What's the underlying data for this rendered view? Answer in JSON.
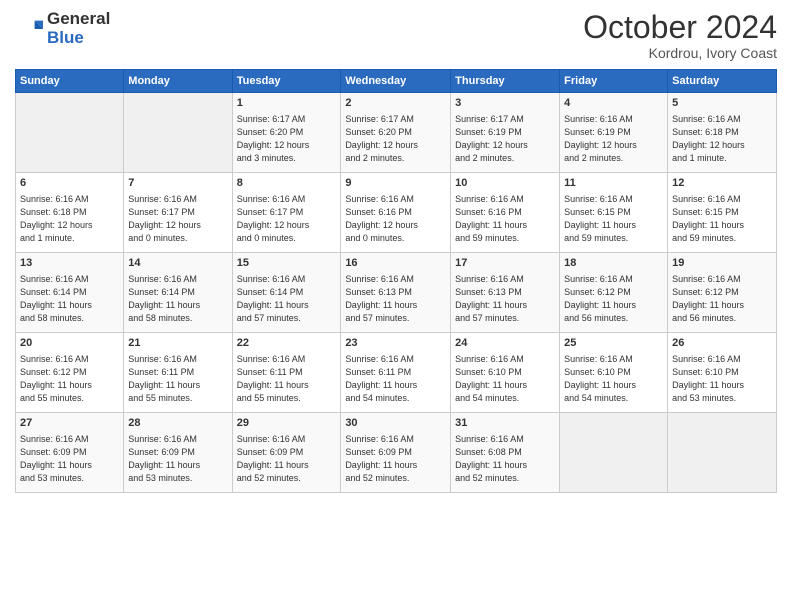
{
  "header": {
    "logo_line1": "General",
    "logo_line2": "Blue",
    "month_title": "October 2024",
    "location": "Kordrou, Ivory Coast"
  },
  "weekdays": [
    "Sunday",
    "Monday",
    "Tuesday",
    "Wednesday",
    "Thursday",
    "Friday",
    "Saturday"
  ],
  "weeks": [
    [
      {
        "num": "",
        "info": ""
      },
      {
        "num": "",
        "info": ""
      },
      {
        "num": "1",
        "info": "Sunrise: 6:17 AM\nSunset: 6:20 PM\nDaylight: 12 hours\nand 3 minutes."
      },
      {
        "num": "2",
        "info": "Sunrise: 6:17 AM\nSunset: 6:20 PM\nDaylight: 12 hours\nand 2 minutes."
      },
      {
        "num": "3",
        "info": "Sunrise: 6:17 AM\nSunset: 6:19 PM\nDaylight: 12 hours\nand 2 minutes."
      },
      {
        "num": "4",
        "info": "Sunrise: 6:16 AM\nSunset: 6:19 PM\nDaylight: 12 hours\nand 2 minutes."
      },
      {
        "num": "5",
        "info": "Sunrise: 6:16 AM\nSunset: 6:18 PM\nDaylight: 12 hours\nand 1 minute."
      }
    ],
    [
      {
        "num": "6",
        "info": "Sunrise: 6:16 AM\nSunset: 6:18 PM\nDaylight: 12 hours\nand 1 minute."
      },
      {
        "num": "7",
        "info": "Sunrise: 6:16 AM\nSunset: 6:17 PM\nDaylight: 12 hours\nand 0 minutes."
      },
      {
        "num": "8",
        "info": "Sunrise: 6:16 AM\nSunset: 6:17 PM\nDaylight: 12 hours\nand 0 minutes."
      },
      {
        "num": "9",
        "info": "Sunrise: 6:16 AM\nSunset: 6:16 PM\nDaylight: 12 hours\nand 0 minutes."
      },
      {
        "num": "10",
        "info": "Sunrise: 6:16 AM\nSunset: 6:16 PM\nDaylight: 11 hours\nand 59 minutes."
      },
      {
        "num": "11",
        "info": "Sunrise: 6:16 AM\nSunset: 6:15 PM\nDaylight: 11 hours\nand 59 minutes."
      },
      {
        "num": "12",
        "info": "Sunrise: 6:16 AM\nSunset: 6:15 PM\nDaylight: 11 hours\nand 59 minutes."
      }
    ],
    [
      {
        "num": "13",
        "info": "Sunrise: 6:16 AM\nSunset: 6:14 PM\nDaylight: 11 hours\nand 58 minutes."
      },
      {
        "num": "14",
        "info": "Sunrise: 6:16 AM\nSunset: 6:14 PM\nDaylight: 11 hours\nand 58 minutes."
      },
      {
        "num": "15",
        "info": "Sunrise: 6:16 AM\nSunset: 6:14 PM\nDaylight: 11 hours\nand 57 minutes."
      },
      {
        "num": "16",
        "info": "Sunrise: 6:16 AM\nSunset: 6:13 PM\nDaylight: 11 hours\nand 57 minutes."
      },
      {
        "num": "17",
        "info": "Sunrise: 6:16 AM\nSunset: 6:13 PM\nDaylight: 11 hours\nand 57 minutes."
      },
      {
        "num": "18",
        "info": "Sunrise: 6:16 AM\nSunset: 6:12 PM\nDaylight: 11 hours\nand 56 minutes."
      },
      {
        "num": "19",
        "info": "Sunrise: 6:16 AM\nSunset: 6:12 PM\nDaylight: 11 hours\nand 56 minutes."
      }
    ],
    [
      {
        "num": "20",
        "info": "Sunrise: 6:16 AM\nSunset: 6:12 PM\nDaylight: 11 hours\nand 55 minutes."
      },
      {
        "num": "21",
        "info": "Sunrise: 6:16 AM\nSunset: 6:11 PM\nDaylight: 11 hours\nand 55 minutes."
      },
      {
        "num": "22",
        "info": "Sunrise: 6:16 AM\nSunset: 6:11 PM\nDaylight: 11 hours\nand 55 minutes."
      },
      {
        "num": "23",
        "info": "Sunrise: 6:16 AM\nSunset: 6:11 PM\nDaylight: 11 hours\nand 54 minutes."
      },
      {
        "num": "24",
        "info": "Sunrise: 6:16 AM\nSunset: 6:10 PM\nDaylight: 11 hours\nand 54 minutes."
      },
      {
        "num": "25",
        "info": "Sunrise: 6:16 AM\nSunset: 6:10 PM\nDaylight: 11 hours\nand 54 minutes."
      },
      {
        "num": "26",
        "info": "Sunrise: 6:16 AM\nSunset: 6:10 PM\nDaylight: 11 hours\nand 53 minutes."
      }
    ],
    [
      {
        "num": "27",
        "info": "Sunrise: 6:16 AM\nSunset: 6:09 PM\nDaylight: 11 hours\nand 53 minutes."
      },
      {
        "num": "28",
        "info": "Sunrise: 6:16 AM\nSunset: 6:09 PM\nDaylight: 11 hours\nand 53 minutes."
      },
      {
        "num": "29",
        "info": "Sunrise: 6:16 AM\nSunset: 6:09 PM\nDaylight: 11 hours\nand 52 minutes."
      },
      {
        "num": "30",
        "info": "Sunrise: 6:16 AM\nSunset: 6:09 PM\nDaylight: 11 hours\nand 52 minutes."
      },
      {
        "num": "31",
        "info": "Sunrise: 6:16 AM\nSunset: 6:08 PM\nDaylight: 11 hours\nand 52 minutes."
      },
      {
        "num": "",
        "info": ""
      },
      {
        "num": "",
        "info": ""
      }
    ]
  ]
}
